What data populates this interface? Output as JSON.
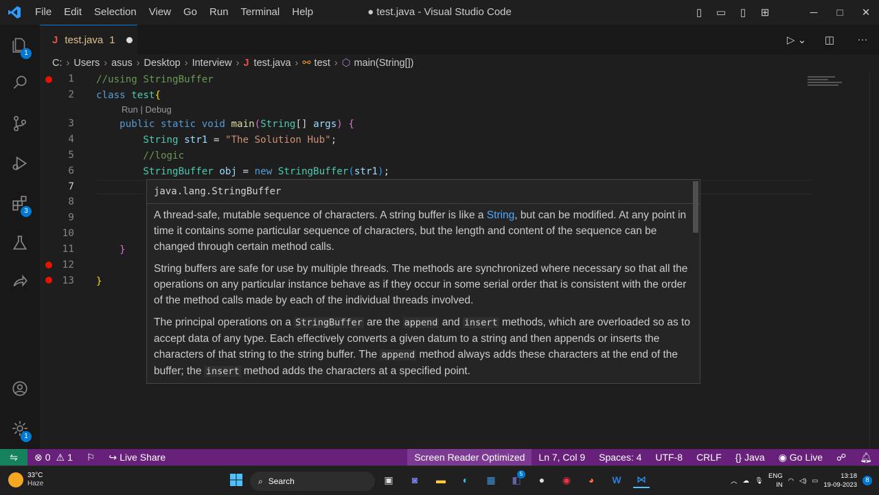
{
  "menu": [
    "File",
    "Edit",
    "Selection",
    "View",
    "Go",
    "Run",
    "Terminal",
    "Help"
  ],
  "window_title": "● test.java - Visual Studio Code",
  "activity_badges": {
    "explorer": "1",
    "extensions": "3",
    "settings": "1"
  },
  "tab": {
    "icon": "J",
    "label": "test.java",
    "problems": "1"
  },
  "breadcrumbs": [
    "C:",
    "Users",
    "asus",
    "Desktop",
    "Interview",
    "test.java",
    "test",
    "main(String[])"
  ],
  "breadcrumb_file_icon": "J",
  "line_numbers": [
    "1",
    "2",
    "3",
    "4",
    "5",
    "6",
    "7",
    "8",
    "9",
    "10",
    "11",
    "12",
    "13"
  ],
  "codelens": "Run | Debug",
  "hover": {
    "signature": "java.lang.StringBuffer",
    "p1_a": "A thread-safe, mutable sequence of characters. A string buffer is like a ",
    "p1_link": "String",
    "p1_b": ", but can be modified. At any point in time it contains some particular sequence of characters, but the length and content of the sequence can be changed through certain method calls.",
    "p2": "String buffers are safe for use by multiple threads. The methods are synchronized where necessary so that all the operations on any particular instance behave as if they occur in some serial order that is consistent with the order of the method calls made by each of the individual threads involved.",
    "p3_a": "The principal operations on a ",
    "p3_c1": "StringBuffer",
    "p3_b": " are the ",
    "p3_c2": "append",
    "p3_c": " and ",
    "p3_c3": "insert",
    "p3_d": " methods, which are overloaded so as to accept data of any type. Each effectively converts a given datum to a string and then appends or inserts the characters of that string to the string buffer. The ",
    "p3_c4": "append",
    "p3_e": " method always adds these characters at the end of the buffer; the ",
    "p3_c5": "insert",
    "p3_f": " method adds the characters at a specified point."
  },
  "status": {
    "errors": "0",
    "warnings": "1",
    "live_share": "Live Share",
    "screen_reader": "Screen Reader Optimized",
    "position": "Ln 7, Col 9",
    "spaces": "Spaces: 4",
    "encoding": "UTF-8",
    "eol": "CRLF",
    "language": "Java",
    "go_live": "Go Live"
  },
  "taskbar": {
    "temp": "33°C",
    "weather": "Haze",
    "search": "Search",
    "lang1": "ENG",
    "lang2": "IN",
    "time": "13:18",
    "date": "19-09-2023",
    "teams_badge": "5",
    "notif": "8"
  },
  "colors": {
    "accent": "#0078d4",
    "statusbar": "#68217a",
    "remote": "#16825d",
    "breakpoint": "#e51400"
  }
}
